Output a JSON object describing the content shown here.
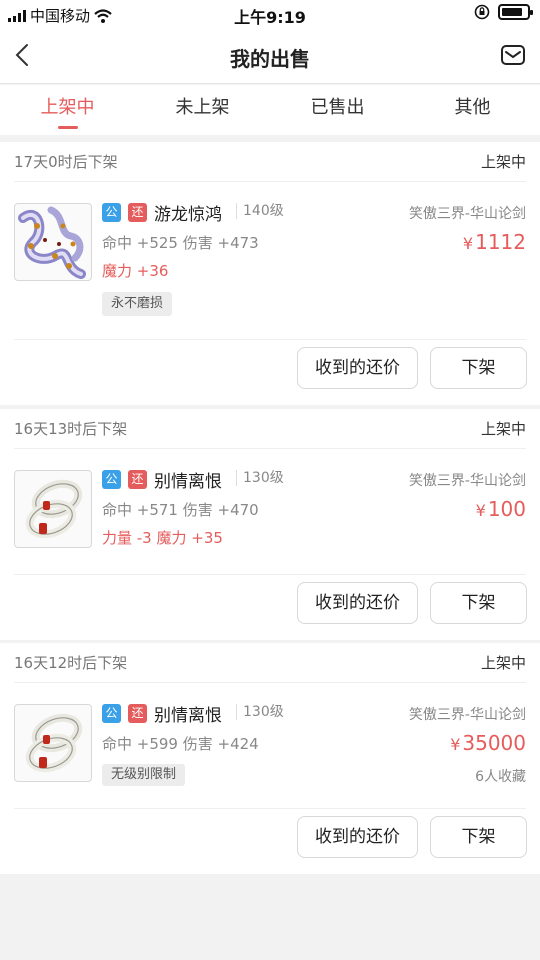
{
  "status_bar": {
    "carrier": "中国移动",
    "time": "上午9:19"
  },
  "header": {
    "title": "我的出售"
  },
  "tabs": [
    {
      "label": "上架中"
    },
    {
      "label": "未上架"
    },
    {
      "label": "已售出"
    },
    {
      "label": "其他"
    }
  ],
  "active_tab": "上架中",
  "colors": {
    "accent": "#e55c5c",
    "public_badge": "#3aa0e8",
    "return_badge": "#e55c5c"
  },
  "listings": [
    {
      "expiry": "17天0时后下架",
      "status": "上架中",
      "badge_public": "公",
      "badge_return": "还",
      "name": "游龙惊鸿",
      "level": "140级",
      "server": "笑傲三界-华山论剑",
      "price_symbol": "¥",
      "price": "1112",
      "stats": "命中 +525 伤害 +473",
      "stats_extra": "魔力 +36",
      "tag": "永不磨损",
      "icon": "dragon-necklace-icon",
      "offer_label": "收到的还价",
      "remove_label": "下架"
    },
    {
      "expiry": "16天13时后下架",
      "status": "上架中",
      "badge_public": "公",
      "badge_return": "还",
      "name": "别情离恨",
      "level": "130级",
      "server": "笑傲三界-华山论剑",
      "price_symbol": "¥",
      "price": "100",
      "stats": "命中 +571 伤害 +470",
      "stats_extra": "力量 -3 魔力 +35",
      "icon": "jade-rings-icon",
      "offer_label": "收到的还价",
      "remove_label": "下架"
    },
    {
      "expiry": "16天12时后下架",
      "status": "上架中",
      "badge_public": "公",
      "badge_return": "还",
      "name": "别情离恨",
      "level": "130级",
      "server": "笑傲三界-华山论剑",
      "price_symbol": "¥",
      "price": "35000",
      "stats": "命中 +599 伤害 +424",
      "tag": "无级别限制",
      "favorites": "6人收藏",
      "icon": "jade-rings-icon",
      "offer_label": "收到的还价",
      "remove_label": "下架"
    }
  ]
}
